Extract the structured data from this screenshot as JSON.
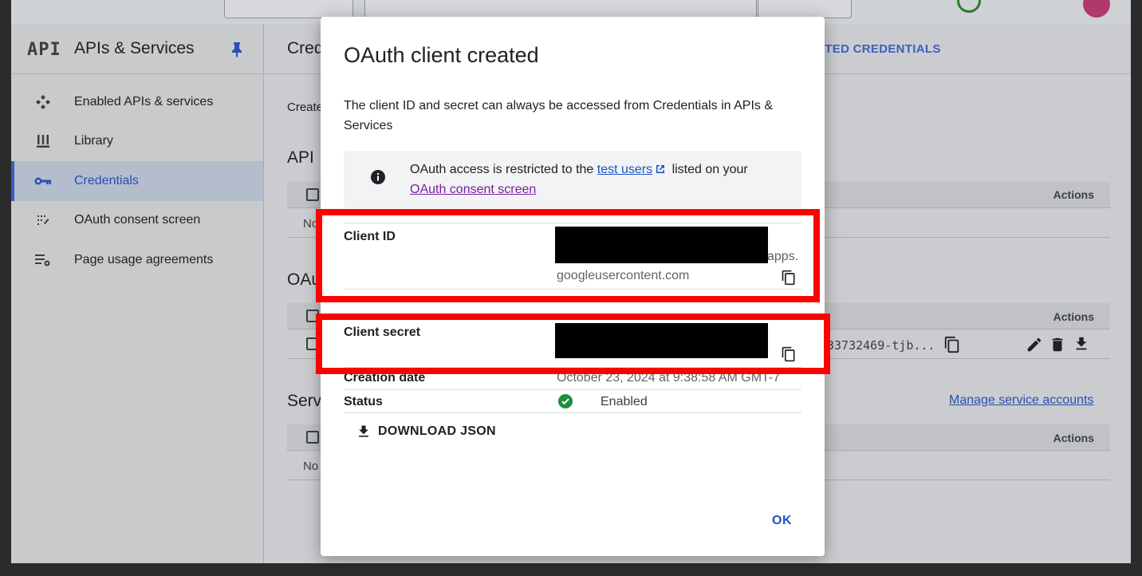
{
  "sidebar": {
    "logo": "API",
    "title": "APIs & Services",
    "items": [
      {
        "label": "Enabled APIs & services"
      },
      {
        "label": "Library"
      },
      {
        "label": "Credentials"
      },
      {
        "label": "OAuth consent screen"
      },
      {
        "label": "Page usage agreements"
      }
    ]
  },
  "main": {
    "title_fragment": "Cred",
    "protected_fragment": "ETED CREDENTIALS",
    "create_fragment": "Create",
    "api_section_fragment": "API",
    "oauth_section_fragment": "OAu",
    "service_section_fragment": "Serv",
    "actions_label": "Actions",
    "no_fragment": "No",
    "client_id_fragment": "33732469-tjb...",
    "manage_link": "Manage service accounts"
  },
  "dialog": {
    "title": "OAuth client created",
    "description": "The client ID and secret can always be accessed from Credentials in APIs & Services",
    "info": {
      "text_before": "OAuth access is restricted to the ",
      "test_users_link": "test users",
      "text_after": " listed on your ",
      "consent_link": "OAuth consent screen"
    },
    "client_id_label": "Client ID",
    "client_id_suffix": "apps.",
    "client_id_domain": "googleusercontent.com",
    "client_secret_label": "Client secret",
    "creation_date_label": "Creation date",
    "creation_date_value": "October 23, 2024 at 9:38:58 AM GMT-7",
    "status_label": "Status",
    "status_value": "Enabled",
    "download_label": "DOWNLOAD JSON",
    "ok_label": "OK"
  },
  "colors": {
    "accent": "#1a56c4",
    "highlight": "#ff0000",
    "status_green": "#1e8e3e"
  }
}
